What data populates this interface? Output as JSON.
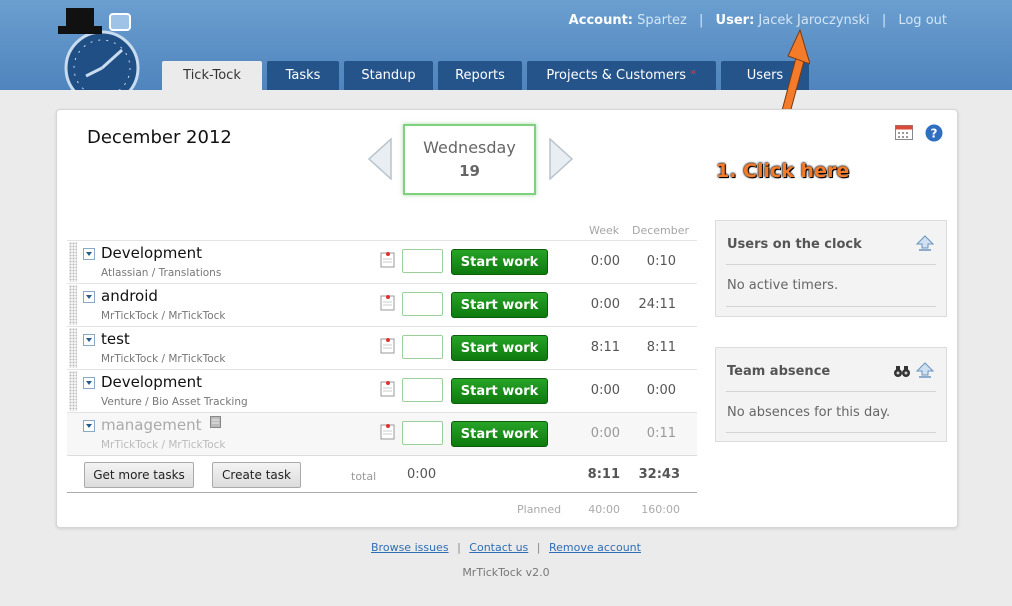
{
  "header": {
    "account_label": "Account:",
    "account_value": "Spartez",
    "user_label": "User:",
    "user_value": "Jacek Jaroczynski",
    "logout": "Log out",
    "separator": "|"
  },
  "tabs": [
    {
      "label": "Tick-Tock",
      "active": true
    },
    {
      "label": "Tasks",
      "active": false
    },
    {
      "label": "Standup",
      "active": false
    },
    {
      "label": "Reports",
      "active": false
    },
    {
      "label": "Projects & Customers",
      "active": false,
      "marker": "*"
    },
    {
      "label": "Users",
      "active": false
    }
  ],
  "calendar": {
    "month": "December 2012",
    "weekday": "Wednesday",
    "day": "19"
  },
  "annotation": "1. Click here",
  "columns": {
    "week": "Week",
    "month": "December"
  },
  "tasks": [
    {
      "name": "Development",
      "sub": "Atlassian / Translations",
      "week": "0:00",
      "month": "0:10",
      "start_label": "Start work",
      "input": ""
    },
    {
      "name": "android",
      "sub": "MrTickTock / MrTickTock",
      "week": "0:00",
      "month": "24:11",
      "start_label": "Start work",
      "input": ""
    },
    {
      "name": "test",
      "sub": "MrTickTock / MrTickTock",
      "week": "8:11",
      "month": "8:11",
      "start_label": "Start work",
      "input": ""
    },
    {
      "name": "Development",
      "sub": "Venture / Bio Asset Tracking",
      "week": "0:00",
      "month": "0:00",
      "start_label": "Start work",
      "input": ""
    },
    {
      "name": "management",
      "sub": "MrTickTock / MrTickTock",
      "week": "0:00",
      "month": "0:11",
      "start_label": "Start work",
      "input": ""
    }
  ],
  "actions": {
    "more_tasks": "Get more tasks",
    "create_task": "Create task"
  },
  "totals": {
    "label": "total",
    "today": "0:00",
    "week": "8:11",
    "month": "32:43"
  },
  "planned": {
    "label": "Planned",
    "week": "40:00",
    "month": "160:00"
  },
  "sidebar": {
    "users_title": "Users on the clock",
    "users_text": "No active timers.",
    "absence_title": "Team absence",
    "absence_text": "No absences for this day."
  },
  "footer": {
    "browse": "Browse issues",
    "contact": "Contact us",
    "remove": "Remove account",
    "separator": "|",
    "version": "MrTickTock v2.0"
  },
  "colors": {
    "header": "#5a8fc6",
    "tab": "#24548a",
    "start_button": "#138a13",
    "annotation": "#f47b2a"
  },
  "icons": [
    "stopwatch-logo-icon",
    "calendar-icon",
    "help-icon",
    "note-icon",
    "lock-icon",
    "collapse-icon",
    "binoculars-icon"
  ]
}
